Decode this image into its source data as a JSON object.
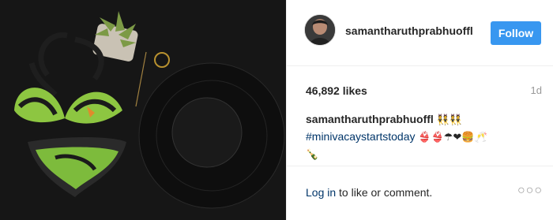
{
  "post": {
    "username": "samantharuthprabhuoffl",
    "follow_label": "Follow",
    "likes": "46,892 likes",
    "time": "1d",
    "caption": {
      "username": "samantharuthprabhuoffl",
      "emoji_line1": "👯👯",
      "hashtag": "#minivacaystartstoday",
      "emoji_line2": "👙👙☂❤🍔🥂",
      "emoji_line3": "🍾"
    },
    "login_link": "Log in",
    "login_rest": " to like or comment.",
    "more_label": "○○○"
  },
  "colors": {
    "follow_button": "#3897f0",
    "hashtag": "#003569",
    "photo_background": "#141414"
  },
  "icons": {
    "more": "more-options-icon",
    "avatar": "profile-avatar"
  }
}
